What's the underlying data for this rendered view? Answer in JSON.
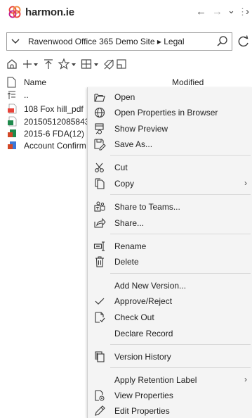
{
  "app": {
    "brand": "harmon.ie"
  },
  "nav": {
    "back": "←",
    "forward": "→",
    "dropdown": "⌄",
    "more": "⋮",
    "expand": "›"
  },
  "address": {
    "path": "Ravenwood Office 365 Demo Site ▸ Legal"
  },
  "columns": {
    "name": "Name",
    "modified": "Modified"
  },
  "rows": [
    {
      "name": "..",
      "icon": "up-folder-icon"
    },
    {
      "name": "108 Fox hill_pdf",
      "icon": "pdf-file-icon"
    },
    {
      "name": "20150512085843",
      "icon": "excel-file-icon"
    },
    {
      "name": "2015-6 FDA(12)",
      "icon": "excel-file-icon"
    },
    {
      "name": "Account Confirm",
      "icon": "powerpoint-file-icon"
    }
  ],
  "menu": {
    "items": [
      {
        "label": "Open",
        "icon": "folder-open-icon"
      },
      {
        "label": "Open Properties in Browser",
        "icon": "globe-icon"
      },
      {
        "label": "Show Preview",
        "icon": "preview-icon"
      },
      {
        "label": "Save As...",
        "icon": "save-as-icon"
      },
      {
        "label": "Cut",
        "icon": "scissors-icon"
      },
      {
        "label": "Copy",
        "icon": "copy-icon",
        "submenu": "›"
      },
      {
        "label": "Share to Teams...",
        "icon": "teams-icon"
      },
      {
        "label": "Share...",
        "icon": "share-icon"
      },
      {
        "label": "Rename",
        "icon": "rename-icon"
      },
      {
        "label": "Delete",
        "icon": "trash-icon"
      },
      {
        "label": "Add New Version...",
        "icon": ""
      },
      {
        "label": "Approve/Reject",
        "icon": "checkmark-icon"
      },
      {
        "label": "Check Out",
        "icon": "check-out-icon"
      },
      {
        "label": "Declare Record",
        "icon": ""
      },
      {
        "label": "Version History",
        "icon": "version-history-icon"
      },
      {
        "label": "Apply Retention Label",
        "icon": "",
        "submenu": "›"
      },
      {
        "label": "View Properties",
        "icon": "view-properties-icon"
      },
      {
        "label": "Edit Properties",
        "icon": "pencil-icon"
      }
    ]
  },
  "colors": {
    "accent_red": "#e8433a",
    "excel_green": "#1f8a4c",
    "ppt_red": "#d24726",
    "teams_purple": "#5b5fc7"
  }
}
